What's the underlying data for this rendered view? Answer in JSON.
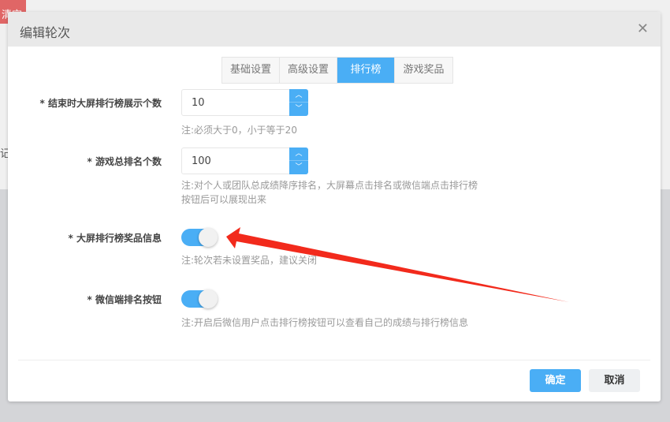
{
  "background": {
    "clear_button": "清空",
    "partial_text": "记"
  },
  "modal": {
    "title": "编辑轮次",
    "close_icon": "close-icon",
    "tabs": [
      {
        "label": "基础设置"
      },
      {
        "label": "高级设置"
      },
      {
        "label": "排行榜",
        "active": true
      },
      {
        "label": "游戏奖品"
      }
    ],
    "fields": {
      "display_count": {
        "label": "* 结束时大屏排行榜展示个数",
        "value": "10",
        "hint": "注:必须大于0，小于等于20"
      },
      "rank_count": {
        "label": "* 游戏总排名个数",
        "value": "100",
        "hint": "注:对个人或团队总成绩降序排名，大屏幕点击排名或微信端点击排行榜",
        "hint2": "按钮后可以展现出来"
      },
      "prize_info": {
        "label": "* 大屏排行榜奖品信息",
        "on": true,
        "hint": "注:轮次若未设置奖品，建议关闭"
      },
      "wechat_button": {
        "label": "* 微信端排名按钮",
        "on": true,
        "hint": "注:开启后微信用户点击排行榜按钮可以查看自己的成绩与排行榜信息"
      }
    },
    "confirm": "确定",
    "cancel": "取消"
  },
  "colors": {
    "accent": "#4aaef5",
    "arrow": "#f22a1c"
  }
}
